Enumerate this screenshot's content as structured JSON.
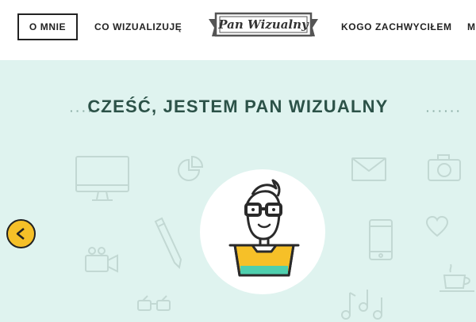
{
  "nav": {
    "items": [
      {
        "label": "O MNIE",
        "active": true
      },
      {
        "label": "CO WIZUALIZUJĘ",
        "active": false
      },
      {
        "label": "KOGO ZACHWYCIŁEM",
        "active": false
      },
      {
        "label": "M",
        "active": false
      }
    ],
    "logo_text": "Pan Wizualny"
  },
  "hero": {
    "heading": "CZEŚĆ, JESTEM PAN WIZUALNY",
    "background_color": "#dff3ef",
    "accent_color": "#f6c028",
    "icons": [
      "monitor-icon",
      "pie-chart-icon",
      "pencil-icon",
      "video-camera-icon",
      "glasses-icon",
      "envelope-icon",
      "camera-icon",
      "heart-icon",
      "smartphone-icon",
      "coffee-cup-icon",
      "music-notes-icon"
    ],
    "prev_icon": "chevron-left-icon"
  }
}
